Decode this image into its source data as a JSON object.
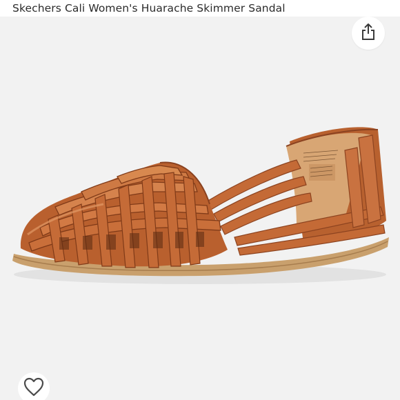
{
  "header": {
    "title": "Skechers Cali Women's Huarache Skimmer Sandal"
  },
  "actions": {
    "share_icon": "share-icon",
    "wishlist_icon": "heart-outline-icon"
  },
  "product_image": {
    "subject": "brown woven leather huarache flat sandal",
    "colors": {
      "leather": "#c06a3a",
      "leather_dark": "#8e4522",
      "leather_light": "#d98856",
      "lining": "#d9a77a",
      "sole": "#caa070"
    }
  }
}
